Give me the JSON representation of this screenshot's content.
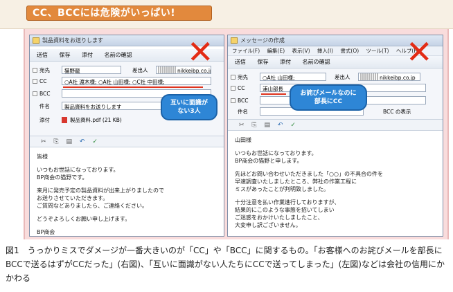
{
  "banner": {
    "title": "CC、BCCには危険がいっぱい!"
  },
  "left": {
    "title": "製品資料をお送りします",
    "toolbar": [
      "送信",
      "保存",
      "添付",
      "名前の確認"
    ],
    "to_label": "宛先",
    "to_value": "猫野龍",
    "from_label": "差出人",
    "from_value": "nikkeibp.co.jp",
    "cc_label": "CC",
    "cc_value": "○A社 渡木様; ○A社 山田様; ○C社 中田様;",
    "bcc_label": "BCC",
    "subject_label": "件名",
    "subject_value": "製品資料をお送りします",
    "attach_label": "添付",
    "attach_value": "製品資料.pdf (21 KB)",
    "body": [
      "皆様",
      "",
      "いつもお世話になっております。",
      "BP商会の猫野です。",
      "",
      "来月に発売予定の製品資料が出来上がりましたので",
      "お送りさせていただきます。",
      "ご質問などありましたら、ご連絡ください。",
      "",
      "どうぞよろしくお願い申し上げます。",
      "",
      "BP商会"
    ],
    "bubble": "互いに面識が\nない3人"
  },
  "right": {
    "title": "メッセージの作成",
    "menu": [
      "ファイル(F)",
      "編集(E)",
      "表示(V)",
      "挿入(I)",
      "書式(O)",
      "ツール(T)",
      "ヘルプ(H)"
    ],
    "toolbar": [
      "送信",
      "保存",
      "添付",
      "名前の確認"
    ],
    "to_label": "宛先",
    "to_value": "○A社 山田様;",
    "from_label": "差出人",
    "from_value": "nikkeibp.co.jp",
    "cc_label": "CC",
    "cc_value": "浦山部長",
    "bcc_label": "BCC",
    "subject_label": "件名",
    "bcc_show": "BCC の表示",
    "body": [
      "山田様",
      "",
      "いつもお世話になっております。",
      "BP商会の猫野と申します。",
      "",
      "先ほどお問い合わせいただきました「○○」の不具合の件を",
      "早速調査いたしましたところ、弊社の作業工程に",
      "ミスがあったことが判明致しました。",
      "",
      "十分注意を払い作業進行しておりますが、",
      "結果的にこのような事態を招いてしまい",
      "ご迷惑をおかけいたしましたこと、",
      "大変申し訳ございません。"
    ],
    "bubble": "お詫びメールなのに\n部長にCC"
  },
  "caption": "図1　うっかりミスでダメージが一番大きいのが「CC」や「BCC」に関するもの。「お客様へのお詫びメールを部長にBCCで送るはずがCCだった」(右図)、「互いに面識がない人たちにCCで送ってしまった」(左図)などは会社の信用にかかわる",
  "colors": {
    "banner": "#e2893d",
    "frame": "#f9dcdc",
    "bubble": "#2e86d6",
    "xmark": "#e32b14"
  }
}
